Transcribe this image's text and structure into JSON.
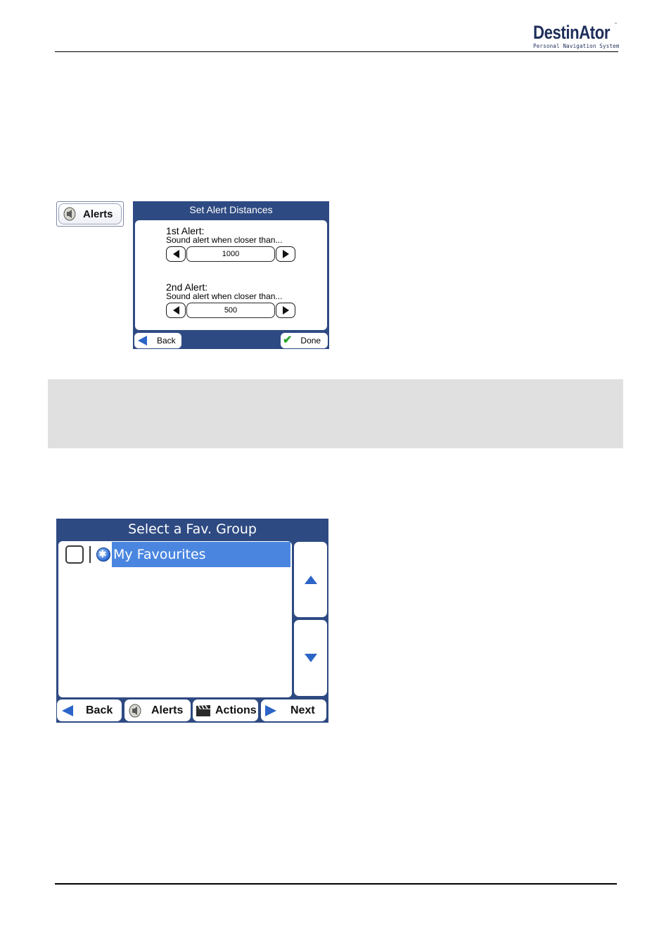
{
  "header": {
    "logo_main": "DestinAtor",
    "logo_tm": "™",
    "logo_sub": "Personal Navigation System"
  },
  "alerts_button": {
    "label": "Alerts",
    "icon": "speaker-icon"
  },
  "screen1": {
    "title": "Set Alert Distances",
    "alert1": {
      "heading": "1st Alert:",
      "sub": "Sound alert when closer than...",
      "value": "1000"
    },
    "alert2": {
      "heading": "2nd Alert:",
      "sub": "Sound alert when closer than...",
      "value": "500"
    },
    "back_label": "Back",
    "done_label": "Done"
  },
  "screen2": {
    "title": "Select a Fav. Group",
    "items": [
      {
        "label": "My Favourites",
        "selected": true
      }
    ],
    "buttons": {
      "back": "Back",
      "alerts": "Alerts",
      "actions": "Actions",
      "next": "Next"
    }
  },
  "colors": {
    "screen_bg": "#2e4a82",
    "accent_blue": "#2c64c8",
    "selection": "#4a86e0",
    "note_band": "#e0e0e0"
  }
}
